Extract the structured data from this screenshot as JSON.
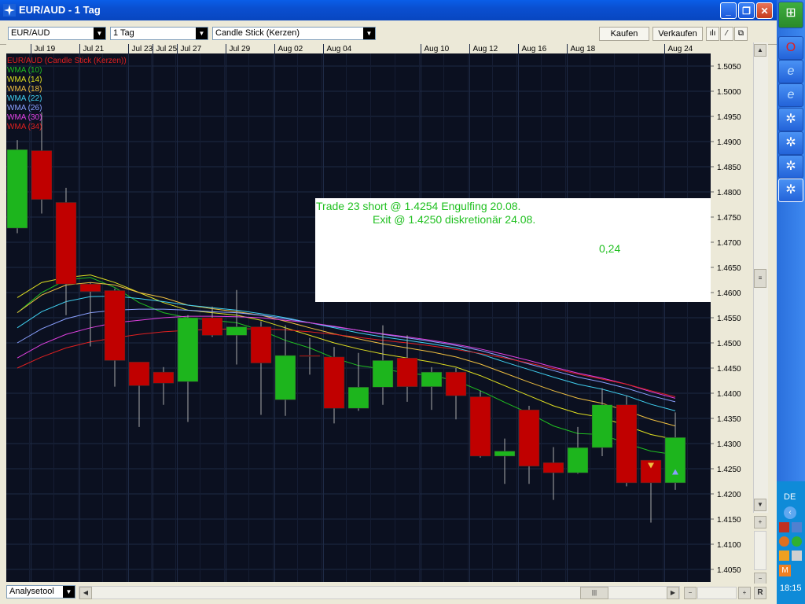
{
  "window": {
    "title": "EUR/AUD - 1 Tag"
  },
  "toolbar": {
    "symbol": "EUR/AUD",
    "period": "1 Tag",
    "chart_style": "Candle Stick (Kerzen)",
    "buy_label": "Kaufen",
    "sell_label": "Verkaufen"
  },
  "bottom": {
    "analysis_tool": "Analysetool",
    "r_label": "R"
  },
  "tray": {
    "lang": "DE",
    "clock": "18:15"
  },
  "annotation": {
    "line1": "Trade 23  short @ 1.4254  Engulfing  20.08.",
    "line2": "Exit  @  1.4250  diskretionär  24.08.",
    "result": "0,24"
  },
  "colors": {
    "background": "#0b1020",
    "grid": "#1e2a45",
    "up": "#1db51d",
    "down": "#c00000",
    "axis_text": "#c8c8c8"
  },
  "chart_data": {
    "type": "candlestick",
    "title": "EUR/AUD (Candle Stick (Kerzen))",
    "ylim": [
      1.4025,
      1.5075
    ],
    "y_ticks": [
      1.505,
      1.5,
      1.495,
      1.49,
      1.485,
      1.48,
      1.475,
      1.47,
      1.465,
      1.46,
      1.455,
      1.45,
      1.445,
      1.44,
      1.435,
      1.43,
      1.425,
      1.42,
      1.415,
      1.41,
      1.405
    ],
    "x_labels": [
      {
        "label": "Jul 19",
        "i": 1
      },
      {
        "label": "Jul 21",
        "i": 3
      },
      {
        "label": "Jul 23",
        "i": 5
      },
      {
        "label": "Jul 25",
        "i": 6
      },
      {
        "label": "Jul 27",
        "i": 7
      },
      {
        "label": "Jul 29",
        "i": 9
      },
      {
        "label": "Aug 02",
        "i": 11
      },
      {
        "label": "Aug 04",
        "i": 13
      },
      {
        "label": "Aug 10",
        "i": 17
      },
      {
        "label": "Aug 12",
        "i": 19
      },
      {
        "label": "Aug 16",
        "i": 21
      },
      {
        "label": "Aug 18",
        "i": 23
      },
      {
        "label": "Aug 24",
        "i": 27
      }
    ],
    "candles": [
      {
        "o": 1.4728,
        "h": 1.4903,
        "l": 1.4718,
        "c": 1.4884
      },
      {
        "o": 1.4882,
        "h": 1.4958,
        "l": 1.4757,
        "c": 1.4785
      },
      {
        "o": 1.4779,
        "h": 1.4808,
        "l": 1.4555,
        "c": 1.4617
      },
      {
        "o": 1.4617,
        "h": 1.462,
        "l": 1.4493,
        "c": 1.4602
      },
      {
        "o": 1.4604,
        "h": 1.4608,
        "l": 1.4413,
        "c": 1.4465
      },
      {
        "o": 1.4462,
        "h": 1.4462,
        "l": 1.4333,
        "c": 1.4415
      },
      {
        "o": 1.4442,
        "h": 1.4452,
        "l": 1.4377,
        "c": 1.442
      },
      {
        "o": 1.4423,
        "h": 1.4555,
        "l": 1.4343,
        "c": 1.455
      },
      {
        "o": 1.455,
        "h": 1.4572,
        "l": 1.4512,
        "c": 1.4515
      },
      {
        "o": 1.4515,
        "h": 1.4605,
        "l": 1.4457,
        "c": 1.4532
      },
      {
        "o": 1.4532,
        "h": 1.4543,
        "l": 1.4357,
        "c": 1.446
      },
      {
        "o": 1.4387,
        "h": 1.4535,
        "l": 1.4355,
        "c": 1.4475
      },
      {
        "o": 1.4475,
        "h": 1.451,
        "l": 1.4437,
        "c": 1.4473
      },
      {
        "o": 1.4472,
        "h": 1.4492,
        "l": 1.434,
        "c": 1.437
      },
      {
        "o": 1.437,
        "h": 1.448,
        "l": 1.4365,
        "c": 1.4412
      },
      {
        "o": 1.4412,
        "h": 1.4535,
        "l": 1.4377,
        "c": 1.4465
      },
      {
        "o": 1.447,
        "h": 1.4515,
        "l": 1.4383,
        "c": 1.4413
      },
      {
        "o": 1.4413,
        "h": 1.4452,
        "l": 1.4367,
        "c": 1.4442
      },
      {
        "o": 1.4442,
        "h": 1.445,
        "l": 1.4348,
        "c": 1.4395
      },
      {
        "o": 1.4393,
        "h": 1.4405,
        "l": 1.4272,
        "c": 1.4275
      },
      {
        "o": 1.4275,
        "h": 1.431,
        "l": 1.422,
        "c": 1.4285
      },
      {
        "o": 1.4367,
        "h": 1.4375,
        "l": 1.422,
        "c": 1.4255
      },
      {
        "o": 1.4262,
        "h": 1.4293,
        "l": 1.4188,
        "c": 1.4242
      },
      {
        "o": 1.4242,
        "h": 1.4333,
        "l": 1.424,
        "c": 1.4292
      },
      {
        "o": 1.4292,
        "h": 1.441,
        "l": 1.4275,
        "c": 1.4377
      },
      {
        "o": 1.4377,
        "h": 1.4395,
        "l": 1.4215,
        "c": 1.4222
      },
      {
        "o": 1.4267,
        "h": 1.4267,
        "l": 1.4143,
        "c": 1.4222
      },
      {
        "o": 1.4222,
        "h": 1.4362,
        "l": 1.4208,
        "c": 1.4312
      }
    ],
    "series": [
      {
        "name": "WMA (10)",
        "color": "#20c020",
        "values": [
          1.456,
          1.46,
          1.4625,
          1.463,
          1.461,
          1.458,
          1.456,
          1.455,
          1.4545,
          1.454,
          1.4525,
          1.4505,
          1.449,
          1.447,
          1.4455,
          1.4448,
          1.444,
          1.4435,
          1.4425,
          1.4405,
          1.4382,
          1.436,
          1.4335,
          1.432,
          1.4318,
          1.43,
          1.4285,
          1.4278
        ]
      },
      {
        "name": "WMA (14)",
        "color": "#e0e020",
        "values": [
          1.459,
          1.462,
          1.463,
          1.4635,
          1.462,
          1.46,
          1.458,
          1.4565,
          1.456,
          1.4555,
          1.4545,
          1.453,
          1.4515,
          1.45,
          1.4488,
          1.4478,
          1.447,
          1.4462,
          1.4452,
          1.4435,
          1.4415,
          1.4395,
          1.4375,
          1.436,
          1.4352,
          1.4335,
          1.4318,
          1.4308
        ]
      },
      {
        "name": "WMA (18)",
        "color": "#f0c040",
        "values": [
          1.456,
          1.4595,
          1.4615,
          1.462,
          1.4615,
          1.46,
          1.459,
          1.4575,
          1.4568,
          1.4562,
          1.4555,
          1.4543,
          1.453,
          1.4518,
          1.4508,
          1.4498,
          1.449,
          1.4482,
          1.4472,
          1.4458,
          1.444,
          1.4422,
          1.4405,
          1.439,
          1.438,
          1.4365,
          1.4348,
          1.4335
        ]
      },
      {
        "name": "WMA (22)",
        "color": "#40d0f0",
        "values": [
          1.453,
          1.4562,
          1.4582,
          1.4592,
          1.4593,
          1.4588,
          1.4582,
          1.4575,
          1.457,
          1.4565,
          1.4558,
          1.455,
          1.454,
          1.453,
          1.452,
          1.4512,
          1.4505,
          1.4498,
          1.449,
          1.4478,
          1.4462,
          1.4447,
          1.4432,
          1.4418,
          1.4408,
          1.4395,
          1.4378,
          1.4365
        ]
      },
      {
        "name": "WMA (26)",
        "color": "#8aa0ff",
        "values": [
          1.45,
          1.4528,
          1.4548,
          1.456,
          1.4565,
          1.4567,
          1.4567,
          1.4565,
          1.4562,
          1.456,
          1.4555,
          1.4548,
          1.454,
          1.4532,
          1.4525,
          1.4517,
          1.451,
          1.4503,
          1.4495,
          1.4485,
          1.4472,
          1.4458,
          1.4445,
          1.4432,
          1.4422,
          1.441,
          1.4395,
          1.4383
        ]
      },
      {
        "name": "WMA (30)",
        "color": "#e040e0",
        "values": [
          1.447,
          1.4497,
          1.4517,
          1.453,
          1.454,
          1.4545,
          1.455,
          1.4553,
          1.4553,
          1.4552,
          1.455,
          1.4545,
          1.454,
          1.4533,
          1.4525,
          1.4518,
          1.4512,
          1.4505,
          1.4497,
          1.4488,
          1.4477,
          1.4465,
          1.4452,
          1.444,
          1.443,
          1.4418,
          1.4403,
          1.439
        ]
      },
      {
        "name": "WMA (34)",
        "color": "#e02020",
        "values": [
          1.445,
          1.4472,
          1.449,
          1.4502,
          1.451,
          1.4517,
          1.4522,
          1.4525,
          1.4527,
          1.4528,
          1.4528,
          1.4526,
          1.4522,
          1.4517,
          1.4511,
          1.4505,
          1.45,
          1.4494,
          1.4487,
          1.4479,
          1.447,
          1.446,
          1.4449,
          1.4438,
          1.4428,
          1.4418,
          1.4405,
          1.4393
        ]
      }
    ],
    "markers": [
      {
        "i": 26,
        "y": 1.4257,
        "shape": "down-triangle",
        "color": "#f0c040"
      },
      {
        "i": 27,
        "y": 1.4243,
        "shape": "up-triangle",
        "color": "#8aa0ff"
      }
    ]
  }
}
